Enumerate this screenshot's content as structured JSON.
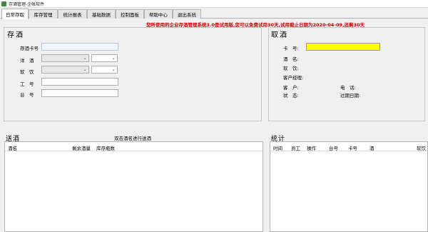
{
  "window": {
    "title": "存酒管理-企帐软件"
  },
  "tabs": [
    {
      "label": "日常存取"
    },
    {
      "label": "库存管理"
    },
    {
      "label": "统计报表"
    },
    {
      "label": "基础数据"
    },
    {
      "label": "控制面板"
    },
    {
      "label": "帮助中心"
    },
    {
      "label": "退出系统"
    }
  ],
  "notice": "您所使用的企业存酒管理系统3.0是试用版,您可以免费试用30天,试用截止日期为2020-04-09,还剩30天",
  "deposit": {
    "title": "存酒",
    "card_label": "存酒卡号",
    "liquor_label": "洋　酒",
    "soft_label": "软　饮",
    "staff_label": "工　号",
    "table_label": "台　号"
  },
  "withdraw": {
    "title": "取酒",
    "card_label": "卡　号:",
    "liquor_label": "酒　名:",
    "soft_label": "软　饮:",
    "manager_label": "客户经理:",
    "customer_label": "客　户:",
    "phone_label": "电　话:",
    "status_label": "状　态:",
    "expiry_label": "过期日期:"
  },
  "send": {
    "title": "送酒",
    "hint": "双击酒名进行送酒",
    "columns": [
      "酒名",
      "剩余酒量",
      "库存瓶数"
    ]
  },
  "stats": {
    "title": "统计",
    "columns": [
      "时间",
      "员工",
      "操作",
      "台号",
      "卡号",
      "酒",
      "软饮"
    ]
  },
  "colors": {
    "notice": "#d40000",
    "highlight": "#ffff00"
  }
}
